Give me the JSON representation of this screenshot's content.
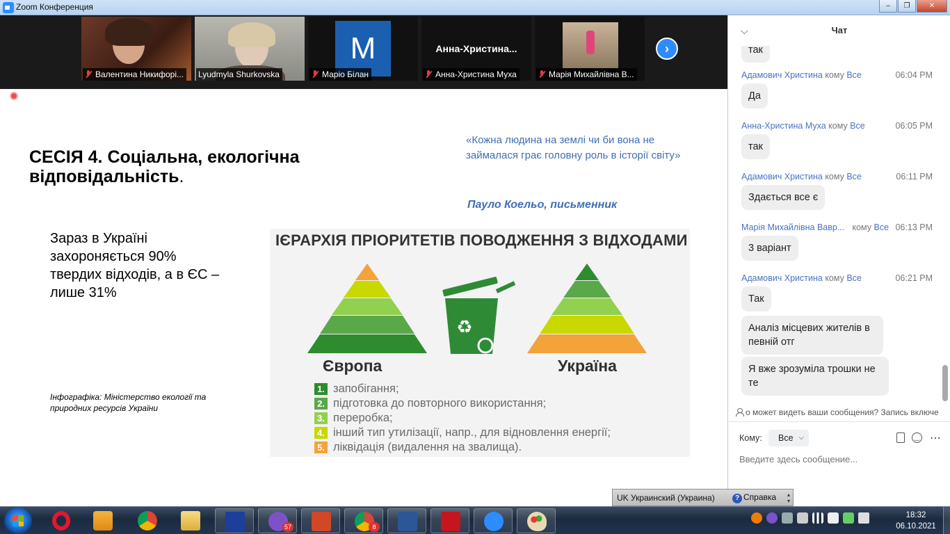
{
  "window": {
    "title": "Zoom Конференция"
  },
  "participants": [
    {
      "name": "Валентина Никифорі...",
      "muted": true
    },
    {
      "name": "Lyudmyla Shurkovska",
      "muted": false,
      "active_speaker": true
    },
    {
      "name": "Маріо Білан",
      "muted": true,
      "initial": "M"
    },
    {
      "name": "Анна-Христина Муха",
      "muted": true,
      "big_name": "Анна-Христина..."
    },
    {
      "name": "Марія Михайлівна В...",
      "muted": true
    }
  ],
  "slide": {
    "title": "СЕСІЯ 4. Соціальна, екологічна відповідальність",
    "title_end": ".",
    "quote": "«Кожна людина на землі чи би вона не займалася грає головну роль в історії світу»",
    "quote_author": "Пауло Коельо, письменник",
    "stat": "Зараз в Україні захороняється 90% твердих відходів, а в ЄС – лише 31%",
    "source": "Інфографіка: Міністерство екології та природних ресурсів України",
    "infographic": {
      "title": "ІЄРАРХІЯ ПРІОРИТЕТІВ ПОВОДЖЕННЯ З ВІДХОДАМИ",
      "left_label": "Європа",
      "right_label": "Україна",
      "legend": [
        {
          "num": "1.",
          "text": "запобігання;",
          "color": "#2e8b2e"
        },
        {
          "num": "2.",
          "text": "підготовка до повторного використання;",
          "color": "#5aa84a"
        },
        {
          "num": "3.",
          "text": "переробка;",
          "color": "#92d050"
        },
        {
          "num": "4.",
          "text": "інший тип утилізації, напр., для відновлення енергії;",
          "color": "#c8d800"
        },
        {
          "num": "5.",
          "text": "ліквідація (видалення на звалища).",
          "color": "#f4a23a"
        }
      ]
    }
  },
  "chat": {
    "title": "Чат",
    "to_word": "кому",
    "to_all": "Все",
    "top_partial": "так",
    "messages": [
      {
        "sender": "Адамович Христина",
        "time": "06:04 PM",
        "texts": [
          "Да"
        ]
      },
      {
        "sender": "Анна-Христина Муха",
        "time": "06:05 PM",
        "texts": [
          "так"
        ]
      },
      {
        "sender": "Адамович Христина",
        "time": "06:11 PM",
        "texts": [
          "Здається все є"
        ]
      },
      {
        "sender": "Марія Михайлівна Вавр...",
        "time": "06:13 PM",
        "texts": [
          "3 варіант"
        ]
      },
      {
        "sender": "Адамович Христина",
        "time": "06:21 PM",
        "texts": [
          "Так",
          "Аналіз місцевих жителів в певній отг",
          "Я вже зрозуміла трошки не те"
        ]
      }
    ],
    "privacy_notice": "о может видеть ваши сообщения? Запись включе",
    "to_label": "Кому:",
    "recipient": "Все",
    "input_placeholder": "Введите здесь сообщение..."
  },
  "langbar": {
    "language": "UK Украинский (Украина)",
    "help": "Справка"
  },
  "taskbar": {
    "badges": {
      "viber": "57",
      "chrome2": "8"
    },
    "time": "18:32",
    "date": "06.10.2021"
  }
}
